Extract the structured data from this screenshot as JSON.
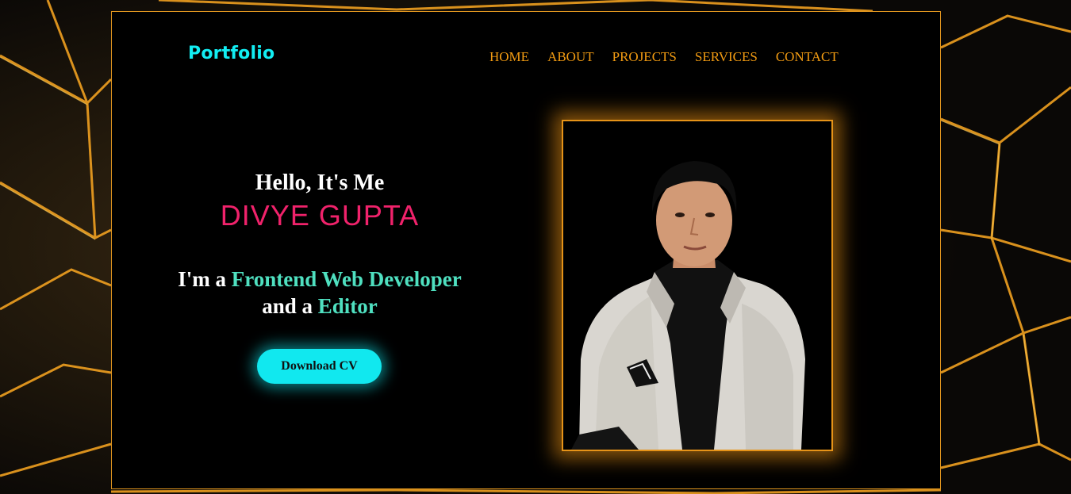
{
  "logo": "Portfolio",
  "nav": {
    "items": [
      "HOME",
      "ABOUT",
      "PROJECTS",
      "SERVICES",
      "CONTACT"
    ]
  },
  "hero": {
    "greeting": "Hello, It's Me",
    "name": "DIVYE GUPTA",
    "role_prefix": "I'm a ",
    "role_primary": "Frontend Web Developer",
    "role_join": "and a ",
    "role_secondary": "Editor",
    "button_label": "Download CV"
  },
  "colors": {
    "accent_cyan": "#12eef3",
    "nav_orange": "#f39c12",
    "name_pink": "#f0226b",
    "highlight_teal": "#4fe0c0",
    "frame_orange": "#e0951f"
  },
  "photo": {
    "alt": "profile-photo"
  }
}
